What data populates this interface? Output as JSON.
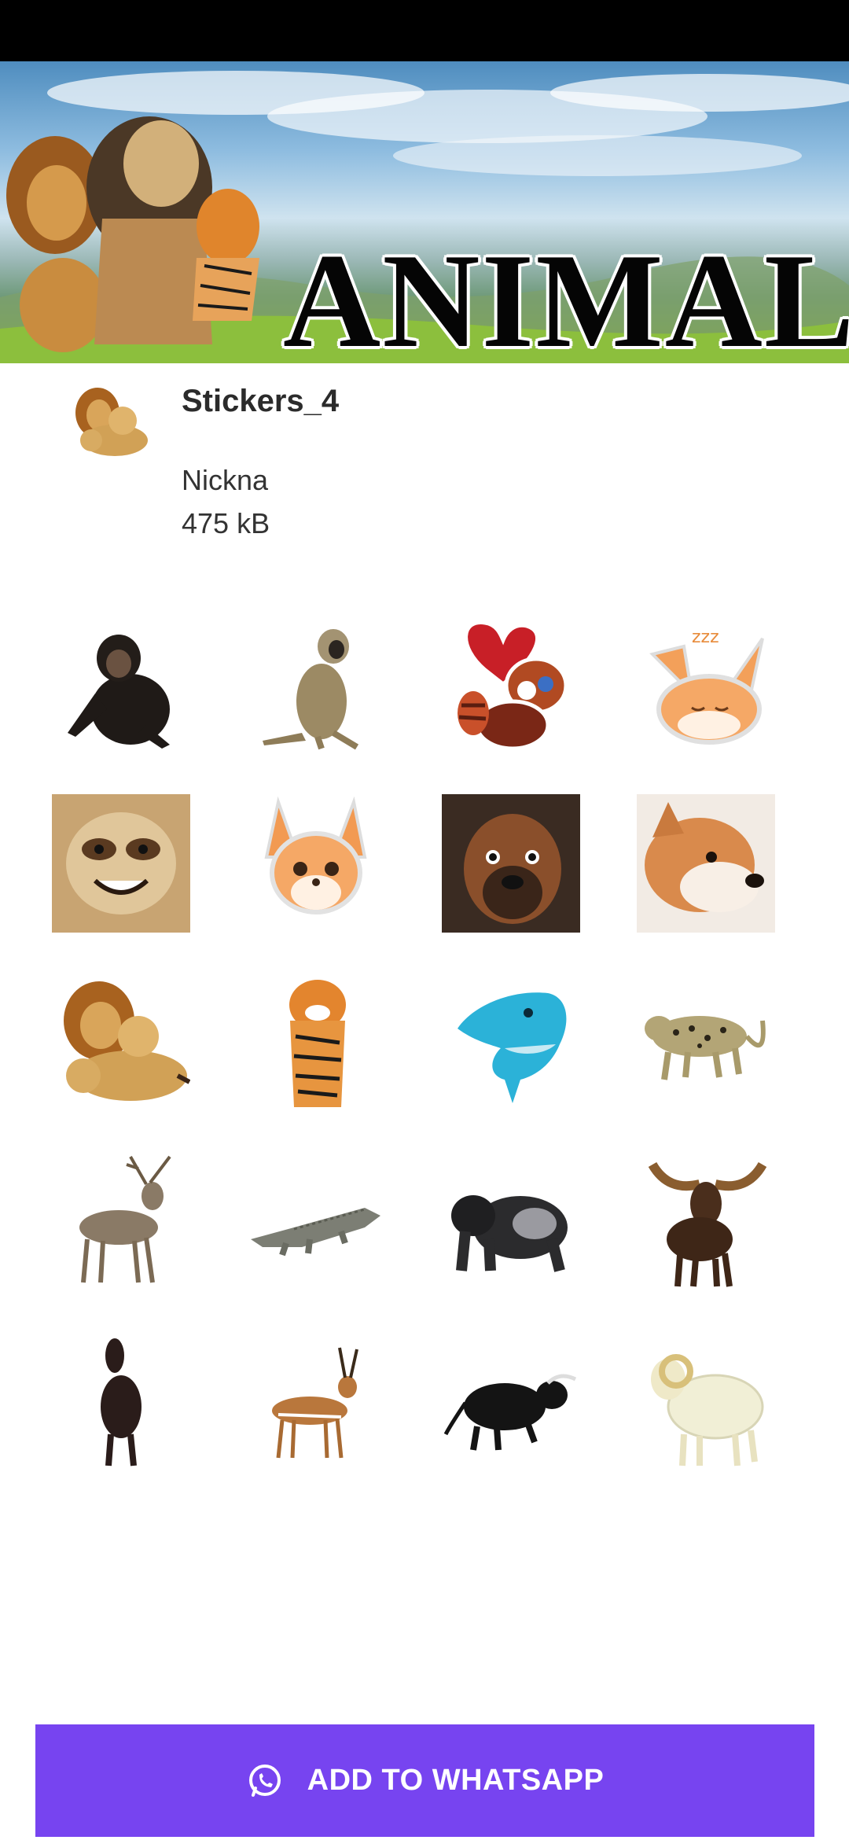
{
  "banner": {
    "title": "ANIMAL"
  },
  "pack": {
    "name": "Stickers_4",
    "author": "Nickna",
    "size": "475 kB",
    "tray_icon": "lion-family-icon"
  },
  "stickers": [
    {
      "name": "chimpanzee-sticker"
    },
    {
      "name": "monkey-sticker"
    },
    {
      "name": "red-panda-heart-sticker"
    },
    {
      "name": "sleeping-fox-sticker"
    },
    {
      "name": "sloth-photo-sticker"
    },
    {
      "name": "cartoon-fox-sticker"
    },
    {
      "name": "boxer-dog-photo-sticker"
    },
    {
      "name": "shiba-dog-photo-sticker"
    },
    {
      "name": "lion-family-sticker"
    },
    {
      "name": "tiger-sticker"
    },
    {
      "name": "dolphin-sticker"
    },
    {
      "name": "leopard-sticker"
    },
    {
      "name": "deer-sticker"
    },
    {
      "name": "crocodile-sticker"
    },
    {
      "name": "gorilla-sticker"
    },
    {
      "name": "moose-sticker"
    },
    {
      "name": "horse-sticker"
    },
    {
      "name": "antelope-sticker"
    },
    {
      "name": "bull-sticker"
    },
    {
      "name": "ram-sticker"
    }
  ],
  "action": {
    "label": "ADD TO WHATSAPP",
    "icon": "whatsapp-icon",
    "color": "#7744f0"
  }
}
